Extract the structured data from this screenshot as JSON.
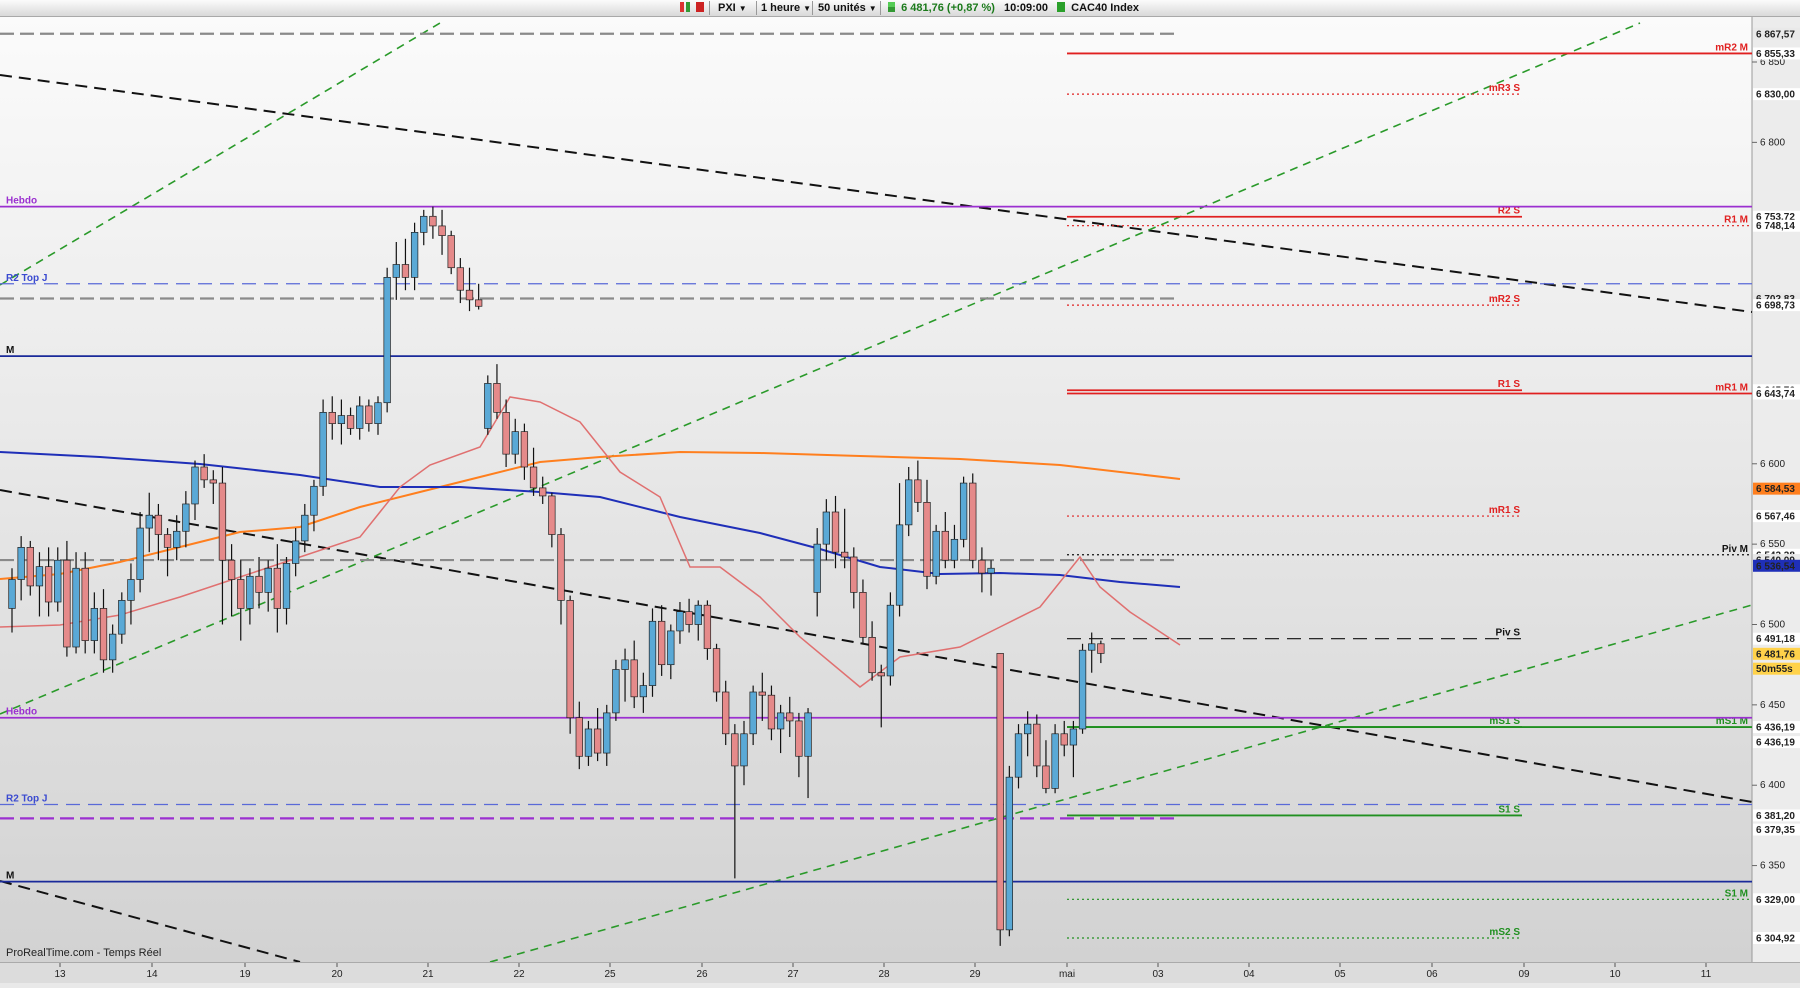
{
  "toolbar": {
    "ticker": "PXI",
    "timeframe": "1 heure",
    "units": "50 unités",
    "quote": "6 481,76 (+0,87 %)",
    "time": "10:09:00",
    "instrument": "CAC40 Index"
  },
  "source": "ProRealTime.com - Temps Réel",
  "colors": {
    "up": "#5aa9d6",
    "down": "#e58a8a",
    "ma_blue": "#1f2fb8",
    "ma_orange": "#ff7f1e",
    "ma_red": "#e07070",
    "resistance": "#e02020",
    "support": "#209020",
    "weekly": "#9b30d0",
    "monthly": "#1a2a9a",
    "trend_green": "#2a9a2a"
  },
  "chart_data": {
    "type": "candlestick",
    "x_ticks": [
      "13",
      "14",
      "19",
      "20",
      "21",
      "22",
      "25",
      "26",
      "27",
      "28",
      "29",
      "mai",
      "03",
      "04",
      "05",
      "06",
      "09",
      "10",
      "11"
    ],
    "y_ticks": [
      "6 850",
      "6 800",
      "6 600",
      "6 550",
      "6 500",
      "6 450",
      "6 400",
      "6 350"
    ],
    "ylim": [
      6290,
      6878
    ],
    "price_labels": [
      {
        "value": "6 867,57",
        "price": 6867.57,
        "bg": "#e9e9e9",
        "fg": "#555"
      },
      {
        "value": "6 855,33",
        "price": 6855.33,
        "bg": "#ffffff",
        "fg": "#e02020"
      },
      {
        "value": "6 830,00",
        "price": 6830.0,
        "bg": "#ffffff",
        "fg": "#e02020"
      },
      {
        "value": "6 753,72",
        "price": 6753.72,
        "bg": "#ffffff",
        "fg": "#e02020"
      },
      {
        "value": "6 748,14",
        "price": 6748.14,
        "bg": "#ffffff",
        "fg": "#e02020"
      },
      {
        "value": "6 702,83",
        "price": 6702.83,
        "bg": "#e9e9e9",
        "fg": "#555"
      },
      {
        "value": "6 698,73",
        "price": 6698.73,
        "bg": "#ffffff",
        "fg": "#e02020"
      },
      {
        "value": "6 645,76",
        "price": 6645.76,
        "bg": "#ffffff",
        "fg": "#e02020"
      },
      {
        "value": "6 643,74",
        "price": 6643.74,
        "bg": "#ffffff",
        "fg": "#e02020"
      },
      {
        "value": "6 584,53",
        "price": 6584.53,
        "bg": "#ff7f1e",
        "fg": "#ffffff"
      },
      {
        "value": "6 567,46",
        "price": 6567.46,
        "bg": "#ffffff",
        "fg": "#e02020"
      },
      {
        "value": "6 543,38",
        "price": 6543.38,
        "bg": "#ffffff",
        "fg": "#111"
      },
      {
        "value": "6 540,09",
        "price": 6540.09,
        "bg": "#e9e9e9",
        "fg": "#555"
      },
      {
        "value": "6 536,54",
        "price": 6536.54,
        "bg": "#1f2fb8",
        "fg": "#ffffff"
      },
      {
        "value": "6 491,18",
        "price": 6491.18,
        "bg": "#ffffff",
        "fg": "#111"
      },
      {
        "value": "6 481,76",
        "price": 6481.76,
        "bg": "#ffd24a",
        "fg": "#111"
      },
      {
        "value": "50m55s",
        "price": 6472.5,
        "bg": "#ffd24a",
        "fg": "#111"
      },
      {
        "value": "6 436,19",
        "price": 6436.19,
        "bg": "#ffffff",
        "fg": "#209020"
      },
      {
        "value": "6 436,19",
        "price": 6426.8,
        "bg": "#ffffff",
        "fg": "#209020"
      },
      {
        "value": "6 381,20",
        "price": 6381.2,
        "bg": "#ffffff",
        "fg": "#209020"
      },
      {
        "value": "6 379,35",
        "price": 6372.4,
        "bg": "#ffffff",
        "fg": "#9b30d0"
      },
      {
        "value": "6 329,00",
        "price": 6329.0,
        "bg": "#ffffff",
        "fg": "#209020"
      },
      {
        "value": "6 304,92",
        "price": 6304.92,
        "bg": "#ffffff",
        "fg": "#209020"
      }
    ],
    "levels": [
      {
        "label": "mR2 M",
        "price": 6855.33,
        "color": "#e02020",
        "style": "solid"
      },
      {
        "label": "mR3 S",
        "price": 6830.0,
        "color": "#e02020",
        "style": "dotted"
      },
      {
        "label": "R2 S",
        "price": 6753.72,
        "color": "#e02020",
        "style": "solid"
      },
      {
        "label": "R1 M",
        "price": 6748.14,
        "color": "#e02020",
        "style": "dotted"
      },
      {
        "label": "mR2 S",
        "price": 6698.73,
        "color": "#e02020",
        "style": "dotted"
      },
      {
        "label": "R1 S",
        "price": 6645.76,
        "color": "#e02020",
        "style": "solid"
      },
      {
        "label": "mR1 M",
        "price": 6643.74,
        "color": "#e02020",
        "style": "solid"
      },
      {
        "label": "mR1 S",
        "price": 6567.46,
        "color": "#e02020",
        "style": "dotted"
      },
      {
        "label": "Piv M",
        "price": 6543.38,
        "color": "#111111",
        "style": "dotted"
      },
      {
        "label": "Piv S",
        "price": 6491.18,
        "color": "#111111",
        "style": "dashed"
      },
      {
        "label": "mS1 S",
        "price": 6436.19,
        "color": "#209020",
        "style": "solid"
      },
      {
        "label": "mS1 M",
        "price": 6436.19,
        "color": "#209020",
        "style": "solid"
      },
      {
        "label": "S1 S",
        "price": 6381.2,
        "color": "#209020",
        "style": "solid"
      },
      {
        "label": "S1 M",
        "price": 6329.0,
        "color": "#209020",
        "style": "dotted"
      },
      {
        "label": "mS2 S",
        "price": 6304.92,
        "color": "#209020",
        "style": "dotted"
      },
      {
        "label": "Hebdo",
        "price": 6760,
        "color": "#9b30d0",
        "style": "solid"
      },
      {
        "label": "R2 Top J",
        "price": 6712,
        "color": "#5a6ad8",
        "style": "dashed"
      },
      {
        "label": "M",
        "price": 6667,
        "color": "#1a2a9a",
        "style": "solid"
      },
      {
        "label": "Hebdo",
        "price": 6442,
        "color": "#9b30d0",
        "style": "solid"
      },
      {
        "label": "R2 Top J",
        "price": 6388,
        "color": "#5a6ad8",
        "style": "dashed"
      },
      {
        "label": "M",
        "price": 6340,
        "color": "#1a2a9a",
        "style": "solid"
      }
    ],
    "candles": [
      [
        6510,
        6535,
        6495,
        6528
      ],
      [
        6528,
        6555,
        6515,
        6548
      ],
      [
        6548,
        6552,
        6518,
        6524
      ],
      [
        6524,
        6545,
        6505,
        6536
      ],
      [
        6536,
        6548,
        6505,
        6514
      ],
      [
        6514,
        6548,
        6508,
        6540
      ],
      [
        6540,
        6552,
        6480,
        6486
      ],
      [
        6486,
        6545,
        6482,
        6535
      ],
      [
        6535,
        6545,
        6482,
        6490
      ],
      [
        6490,
        6520,
        6482,
        6510
      ],
      [
        6510,
        6522,
        6470,
        6478
      ],
      [
        6478,
        6500,
        6470,
        6494
      ],
      [
        6494,
        6520,
        6488,
        6515
      ],
      [
        6515,
        6538,
        6500,
        6528
      ],
      [
        6528,
        6570,
        6520,
        6560
      ],
      [
        6560,
        6582,
        6545,
        6568
      ],
      [
        6568,
        6575,
        6540,
        6556
      ],
      [
        6556,
        6560,
        6530,
        6548
      ],
      [
        6548,
        6568,
        6540,
        6558
      ],
      [
        6558,
        6583,
        6548,
        6575
      ],
      [
        6575,
        6602,
        6565,
        6598
      ],
      [
        6598,
        6606,
        6585,
        6590
      ],
      [
        6590,
        6596,
        6575,
        6588
      ],
      [
        6588,
        6598,
        6500,
        6540
      ],
      [
        6540,
        6550,
        6505,
        6528
      ],
      [
        6528,
        6540,
        6490,
        6510
      ],
      [
        6510,
        6535,
        6500,
        6530
      ],
      [
        6530,
        6542,
        6510,
        6520
      ],
      [
        6520,
        6540,
        6508,
        6535
      ],
      [
        6535,
        6550,
        6495,
        6510
      ],
      [
        6510,
        6542,
        6500,
        6538
      ],
      [
        6538,
        6560,
        6530,
        6552
      ],
      [
        6552,
        6575,
        6545,
        6568
      ],
      [
        6568,
        6590,
        6558,
        6586
      ],
      [
        6586,
        6640,
        6580,
        6632
      ],
      [
        6632,
        6642,
        6615,
        6625
      ],
      [
        6625,
        6640,
        6612,
        6630
      ],
      [
        6630,
        6635,
        6618,
        6622
      ],
      [
        6622,
        6642,
        6615,
        6636
      ],
      [
        6636,
        6640,
        6620,
        6625
      ],
      [
        6625,
        6642,
        6618,
        6638
      ],
      [
        6638,
        6722,
        6632,
        6716
      ],
      [
        6716,
        6738,
        6702,
        6724
      ],
      [
        6724,
        6740,
        6708,
        6716
      ],
      [
        6716,
        6750,
        6708,
        6744
      ],
      [
        6744,
        6758,
        6736,
        6754
      ],
      [
        6754,
        6760,
        6740,
        6748
      ],
      [
        6748,
        6758,
        6730,
        6742
      ],
      [
        6742,
        6745,
        6718,
        6722
      ],
      [
        6722,
        6728,
        6700,
        6708
      ],
      [
        6708,
        6722,
        6695,
        6702
      ],
      [
        6702,
        6712,
        6696,
        6698
      ],
      [
        6622,
        6655,
        6618,
        6650
      ],
      [
        6650,
        6662,
        6628,
        6632
      ],
      [
        6632,
        6640,
        6598,
        6606
      ],
      [
        6606,
        6628,
        6600,
        6620
      ],
      [
        6620,
        6625,
        6590,
        6598
      ],
      [
        6598,
        6610,
        6580,
        6585
      ],
      [
        6585,
        6592,
        6575,
        6580
      ],
      [
        6580,
        6582,
        6548,
        6556
      ],
      [
        6556,
        6560,
        6500,
        6515
      ],
      [
        6515,
        6518,
        6432,
        6442
      ],
      [
        6442,
        6452,
        6410,
        6418
      ],
      [
        6418,
        6440,
        6412,
        6435
      ],
      [
        6435,
        6448,
        6415,
        6420
      ],
      [
        6420,
        6450,
        6412,
        6445
      ],
      [
        6445,
        6478,
        6440,
        6472
      ],
      [
        6472,
        6485,
        6452,
        6478
      ],
      [
        6478,
        6490,
        6448,
        6455
      ],
      [
        6455,
        6470,
        6445,
        6462
      ],
      [
        6462,
        6510,
        6455,
        6502
      ],
      [
        6502,
        6512,
        6468,
        6475
      ],
      [
        6475,
        6500,
        6466,
        6496
      ],
      [
        6496,
        6514,
        6488,
        6508
      ],
      [
        6508,
        6516,
        6495,
        6500
      ],
      [
        6500,
        6515,
        6490,
        6512
      ],
      [
        6512,
        6515,
        6478,
        6485
      ],
      [
        6485,
        6488,
        6452,
        6458
      ],
      [
        6458,
        6465,
        6425,
        6432
      ],
      [
        6432,
        6438,
        6342,
        6412
      ],
      [
        6412,
        6440,
        6400,
        6432
      ],
      [
        6432,
        6462,
        6425,
        6458
      ],
      [
        6458,
        6470,
        6440,
        6456
      ],
      [
        6456,
        6462,
        6428,
        6435
      ],
      [
        6435,
        6450,
        6420,
        6445
      ],
      [
        6445,
        6455,
        6430,
        6440
      ],
      [
        6440,
        6445,
        6405,
        6418
      ],
      [
        6418,
        6448,
        6392,
        6445
      ],
      [
        6520,
        6560,
        6505,
        6550
      ],
      [
        6550,
        6578,
        6540,
        6570
      ],
      [
        6570,
        6580,
        6535,
        6545
      ],
      [
        6545,
        6572,
        6535,
        6542
      ],
      [
        6542,
        6548,
        6510,
        6520
      ],
      [
        6520,
        6528,
        6488,
        6492
      ],
      [
        6492,
        6502,
        6465,
        6470
      ],
      [
        6470,
        6475,
        6436,
        6468
      ],
      [
        6468,
        6520,
        6462,
        6512
      ],
      [
        6512,
        6588,
        6505,
        6562
      ],
      [
        6562,
        6598,
        6555,
        6590
      ],
      [
        6590,
        6602,
        6570,
        6576
      ],
      [
        6576,
        6590,
        6522,
        6530
      ],
      [
        6530,
        6562,
        6525,
        6558
      ],
      [
        6558,
        6570,
        6535,
        6540
      ],
      [
        6540,
        6562,
        6535,
        6553
      ],
      [
        6553,
        6592,
        6548,
        6588
      ],
      [
        6588,
        6594,
        6535,
        6540
      ],
      [
        6540,
        6548,
        6520,
        6532
      ],
      [
        6532,
        6540,
        6518,
        6535
      ],
      [
        6482,
        6482,
        6300,
        6310
      ],
      [
        6310,
        6412,
        6306,
        6405
      ],
      [
        6405,
        6438,
        6398,
        6432
      ],
      [
        6432,
        6446,
        6418,
        6438
      ],
      [
        6438,
        6444,
        6405,
        6412
      ],
      [
        6412,
        6428,
        6395,
        6398
      ],
      [
        6398,
        6438,
        6395,
        6432
      ],
      [
        6432,
        6440,
        6418,
        6425
      ],
      [
        6425,
        6440,
        6405,
        6435
      ],
      [
        6435,
        6488,
        6432,
        6484
      ],
      [
        6484,
        6495,
        6470,
        6488
      ],
      [
        6488,
        6490,
        6476,
        6482
      ]
    ]
  }
}
